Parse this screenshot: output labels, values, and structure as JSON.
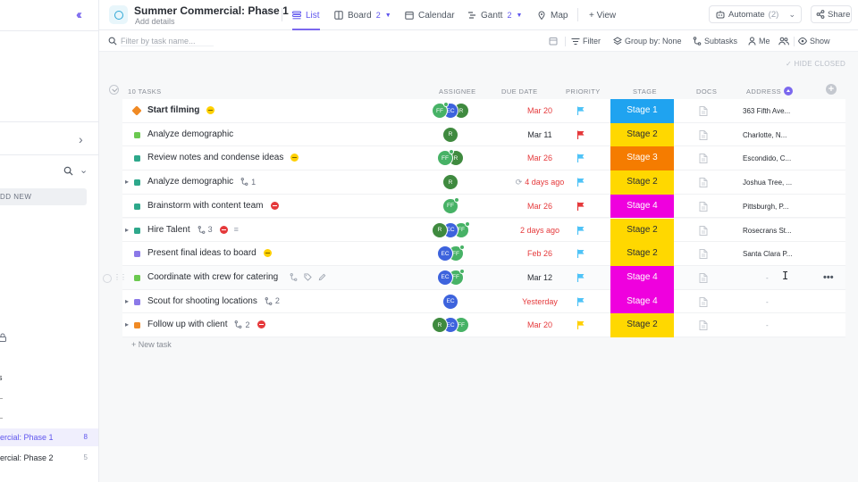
{
  "colors": {
    "accent": "#7b68ee",
    "red": "#e5393b",
    "stage1": "#1fa3f0",
    "stage2": "#ffd800",
    "stage3": "#f57c00",
    "stage4": "#ef00de"
  },
  "sidebar": {
    "collapse_icon": "double-chevron-left-icon",
    "add_new": "DD NEW",
    "section_label": "s",
    "items": [
      {
        "label": "ercial: Phase 1",
        "count": "8"
      },
      {
        "label": "ercial: Phase 2",
        "count": "5"
      }
    ]
  },
  "header": {
    "title": "Summer Commercial: Phase 1",
    "subtitle": "Add details",
    "tabs": [
      {
        "label": "List",
        "icon": "list-icon",
        "count": ""
      },
      {
        "label": "Board",
        "icon": "board-icon",
        "count": "2"
      },
      {
        "label": "Calendar",
        "icon": "calendar-icon",
        "count": ""
      },
      {
        "label": "Gantt",
        "icon": "gantt-icon",
        "count": "2"
      },
      {
        "label": "Map",
        "icon": "map-pin-icon",
        "count": ""
      }
    ],
    "add_view": "+ View",
    "automate": "Automate",
    "automate_count": "(2)",
    "share": "Share"
  },
  "filterbar": {
    "search_placeholder": "Filter by task name...",
    "filter": "Filter",
    "group_by": "Group by: None",
    "subtasks": "Subtasks",
    "me": "Me",
    "show": "Show"
  },
  "table": {
    "hide_closed": "HIDE CLOSED",
    "count_label": "10 TASKS",
    "columns": {
      "assignee": "ASSIGNEE",
      "due_date": "DUE DATE",
      "priority": "PRIORITY",
      "stage": "STAGE",
      "docs": "DOCS",
      "address": "ADDRESS"
    },
    "new_task": "+ New task"
  },
  "tasks": [
    {
      "name": "Start filming",
      "color": "#f08a24",
      "diamond": true,
      "bold": true,
      "expand": false,
      "subtasks": "",
      "status_dot": "yellow",
      "assignees": [
        "FF",
        "EC",
        "R"
      ],
      "due": "Mar 20",
      "due_red": true,
      "priority": "#4fc3f7",
      "stage": "Stage 1",
      "stage_color": "#1fa3f0",
      "address": "363 Fifth Ave..."
    },
    {
      "name": "Analyze demographic",
      "color": "#6bc950",
      "diamond": false,
      "bold": false,
      "expand": false,
      "subtasks": "",
      "status_dot": "",
      "assignees": [
        "R"
      ],
      "due": "Mar 11",
      "due_red": false,
      "priority": "#e5393b",
      "stage": "Stage 2",
      "stage_color": "#ffd800",
      "address": "Charlotte, N..."
    },
    {
      "name": "Review notes and condense ideas",
      "color": "#2ea88b",
      "diamond": false,
      "bold": false,
      "expand": false,
      "subtasks": "",
      "status_dot": "yellow",
      "assignees": [
        "FF",
        "R"
      ],
      "due": "Mar 26",
      "due_red": true,
      "priority": "#4fc3f7",
      "stage": "Stage 3",
      "stage_color": "#f57c00",
      "address": "Escondido, C..."
    },
    {
      "name": "Analyze demographic",
      "color": "#2ea88b",
      "diamond": false,
      "bold": false,
      "expand": true,
      "subtasks": "1",
      "status_dot": "",
      "assignees": [
        "R"
      ],
      "due": "4 days ago",
      "due_red": true,
      "priority": "#4fc3f7",
      "stage": "Stage 2",
      "stage_color": "#ffd800",
      "address": "Joshua Tree, ..."
    },
    {
      "name": "Brainstorm with content team",
      "color": "#2ea88b",
      "diamond": false,
      "bold": false,
      "expand": false,
      "subtasks": "",
      "status_dot": "red",
      "assignees": [
        "FF"
      ],
      "due": "Mar 26",
      "due_red": true,
      "priority": "#e5393b",
      "stage": "Stage 4",
      "stage_color": "#ef00de",
      "address": "Pittsburgh, P..."
    },
    {
      "name": "Hire Talent",
      "color": "#2ea88b",
      "diamond": false,
      "bold": false,
      "expand": true,
      "subtasks": "3",
      "status_dot": "red",
      "assignees": [
        "R",
        "EC",
        "FF"
      ],
      "due": "2 days ago",
      "due_red": true,
      "priority": "#4fc3f7",
      "stage": "Stage 2",
      "stage_color": "#ffd800",
      "address": "Rosecrans St..."
    },
    {
      "name": "Present final ideas to board",
      "color": "#8b79e8",
      "diamond": false,
      "bold": false,
      "expand": false,
      "subtasks": "",
      "status_dot": "yellow",
      "assignees": [
        "EC",
        "FF"
      ],
      "due": "Feb 26",
      "due_red": true,
      "priority": "#4fc3f7",
      "stage": "Stage 2",
      "stage_color": "#ffd800",
      "address": "Santa Clara P..."
    },
    {
      "name": "Coordinate with crew for catering",
      "color": "#6bc950",
      "diamond": false,
      "bold": false,
      "expand": false,
      "subtasks": "",
      "status_dot": "",
      "assignees": [
        "EC",
        "FF"
      ],
      "due": "Mar 12",
      "due_red": false,
      "priority": "#4fc3f7",
      "stage": "Stage 4",
      "stage_color": "#ef00de",
      "address": "-"
    },
    {
      "name": "Scout for shooting locations",
      "color": "#8b79e8",
      "diamond": false,
      "bold": false,
      "expand": true,
      "subtasks": "2",
      "status_dot": "",
      "assignees": [
        "EC"
      ],
      "due": "Yesterday",
      "due_red": true,
      "priority": "#4fc3f7",
      "stage": "Stage 4",
      "stage_color": "#ef00de",
      "address": "-"
    },
    {
      "name": "Follow up with client",
      "color": "#f08a24",
      "diamond": false,
      "bold": false,
      "expand": true,
      "subtasks": "2",
      "status_dot": "red",
      "assignees": [
        "R",
        "EC",
        "FF"
      ],
      "due": "Mar 20",
      "due_red": true,
      "priority": "#ffd000",
      "stage": "Stage 2",
      "stage_color": "#ffd800",
      "address": "-"
    }
  ]
}
